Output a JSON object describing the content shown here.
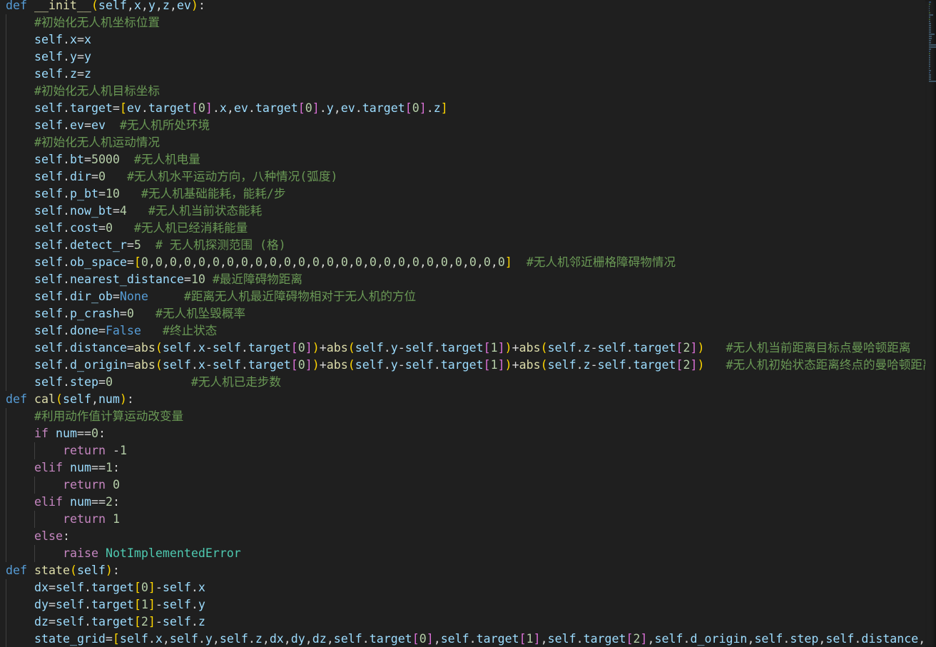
{
  "editor": {
    "language": "python",
    "lines": [
      "def __init__(self,x,y,z,ev):",
      "    #初始化无人机坐标位置",
      "    self.x=x",
      "    self.y=y",
      "    self.z=z",
      "    #初始化无人机目标坐标",
      "    self.target=[ev.target[0].x,ev.target[0].y,ev.target[0].z]",
      "    self.ev=ev  #无人机所处环境",
      "    #初始化无人机运动情况",
      "    self.bt=5000  #无人机电量",
      "    self.dir=0   #无人机水平运动方向，八种情况(弧度)",
      "    self.p_bt=10   #无人机基础能耗，能耗/步",
      "    self.now_bt=4   #无人机当前状态能耗",
      "    self.cost=0   #无人机已经消耗能量",
      "    self.detect_r=5  # 无人机探测范围 (格)",
      "    self.ob_space=[0,0,0,0,0,0,0,0,0,0,0,0,0,0,0,0,0,0,0,0,0,0,0,0,0,0]  #无人机邻近栅格障碍物情况",
      "    self.nearest_distance=10 #最近障碍物距离",
      "    self.dir_ob=None     #距离无人机最近障碍物相对于无人机的方位",
      "    self.p_crash=0   #无人机坠毁概率",
      "    self.done=False   #终止状态",
      "    self.distance=abs(self.x-self.target[0])+abs(self.y-self.target[1])+abs(self.z-self.target[2])   #无人机当前距离目标点曼哈顿距离",
      "    self.d_origin=abs(self.x-self.target[0])+abs(self.y-self.target[1])+abs(self.z-self.target[2])   #无人机初始状态距离终点的曼哈顿距离",
      "    self.step=0           #无人机已走步数",
      "def cal(self,num):",
      "    #利用动作值计算运动改变量",
      "    if num==0:",
      "        return -1",
      "    elif num==1:",
      "        return 0",
      "    elif num==2:",
      "        return 1",
      "    else:",
      "        raise NotImplementedError",
      "def state(self):",
      "    dx=self.target[0]-self.x",
      "    dy=self.target[1]-self.y",
      "    dz=self.target[2]-self.z",
      "    state_grid=[self.x,self.y,self.z,dx,dy,dz,self.target[0],self.target[1],self.target[2],self.d_origin,self.step,self.distance,self.dir,self.dir_ob]"
    ]
  },
  "colors": {
    "background": "#1f1f1f",
    "keyword": "#569cd6",
    "control": "#c586c0",
    "variable": "#9cdcfe",
    "function": "#dcdcaa",
    "number": "#b5cea8",
    "comment": "#6a9955",
    "class": "#4ec9b0"
  }
}
